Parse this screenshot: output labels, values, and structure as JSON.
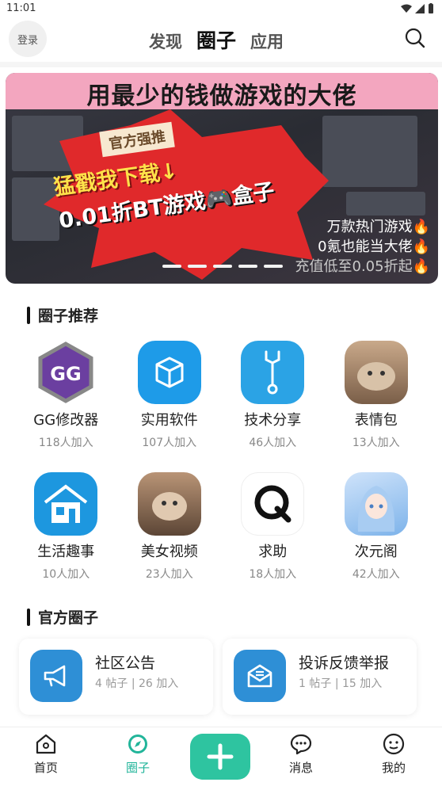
{
  "status_bar": {
    "time": "11:01"
  },
  "header": {
    "login_label": "登录",
    "tabs": [
      {
        "label": "发现",
        "active": false
      },
      {
        "label": "圈子",
        "active": true
      },
      {
        "label": "应用",
        "active": false
      }
    ]
  },
  "banner": {
    "headline": "用最少的钱做游戏的大佬",
    "tag": "官方强推",
    "cta": "猛戳我下载↓",
    "main": "0.01折BT游戏🎮盒子",
    "lines": [
      "万款热门游戏🔥",
      "0氪也能当大佬🔥",
      "充值低至0.05折起🔥"
    ],
    "slide_count": 5
  },
  "recommend": {
    "title": "圈子推荐",
    "circles": [
      {
        "name": "GG修改器",
        "count": "118人加入",
        "icon": "gg-modifier-icon"
      },
      {
        "name": "实用软件",
        "count": "107人加入",
        "icon": "box-icon"
      },
      {
        "name": "技术分享",
        "count": "46人加入",
        "icon": "wrench-icon"
      },
      {
        "name": "表情包",
        "count": "13人加入",
        "icon": "cat-meme-icon"
      },
      {
        "name": "生活趣事",
        "count": "10人加入",
        "icon": "house-icon"
      },
      {
        "name": "美女视频",
        "count": "23人加入",
        "icon": "cat-meme-icon"
      },
      {
        "name": "求助",
        "count": "18人加入",
        "icon": "q-logo-icon"
      },
      {
        "name": "次元阁",
        "count": "42人加入",
        "icon": "anime-girl-icon"
      }
    ]
  },
  "official": {
    "title": "官方圈子",
    "cards": [
      {
        "title": "社区公告",
        "posts": "4 帖子",
        "joined": "26 加入",
        "icon": "megaphone-icon"
      },
      {
        "title": "投诉反馈举报",
        "posts": "1 帖子",
        "joined": "15 加入",
        "icon": "mail-icon"
      }
    ]
  },
  "bottom_nav": {
    "items": [
      {
        "label": "首页",
        "icon": "home-icon"
      },
      {
        "label": "圈子",
        "icon": "compass-icon",
        "active": true
      },
      {
        "label": "消息",
        "icon": "chat-icon"
      },
      {
        "label": "我的",
        "icon": "profile-icon"
      }
    ],
    "add_icon": "plus-icon"
  },
  "colors": {
    "accent": "#22b59a",
    "add_button": "#2ec4a0",
    "official_icon": "#2e8fd6"
  }
}
